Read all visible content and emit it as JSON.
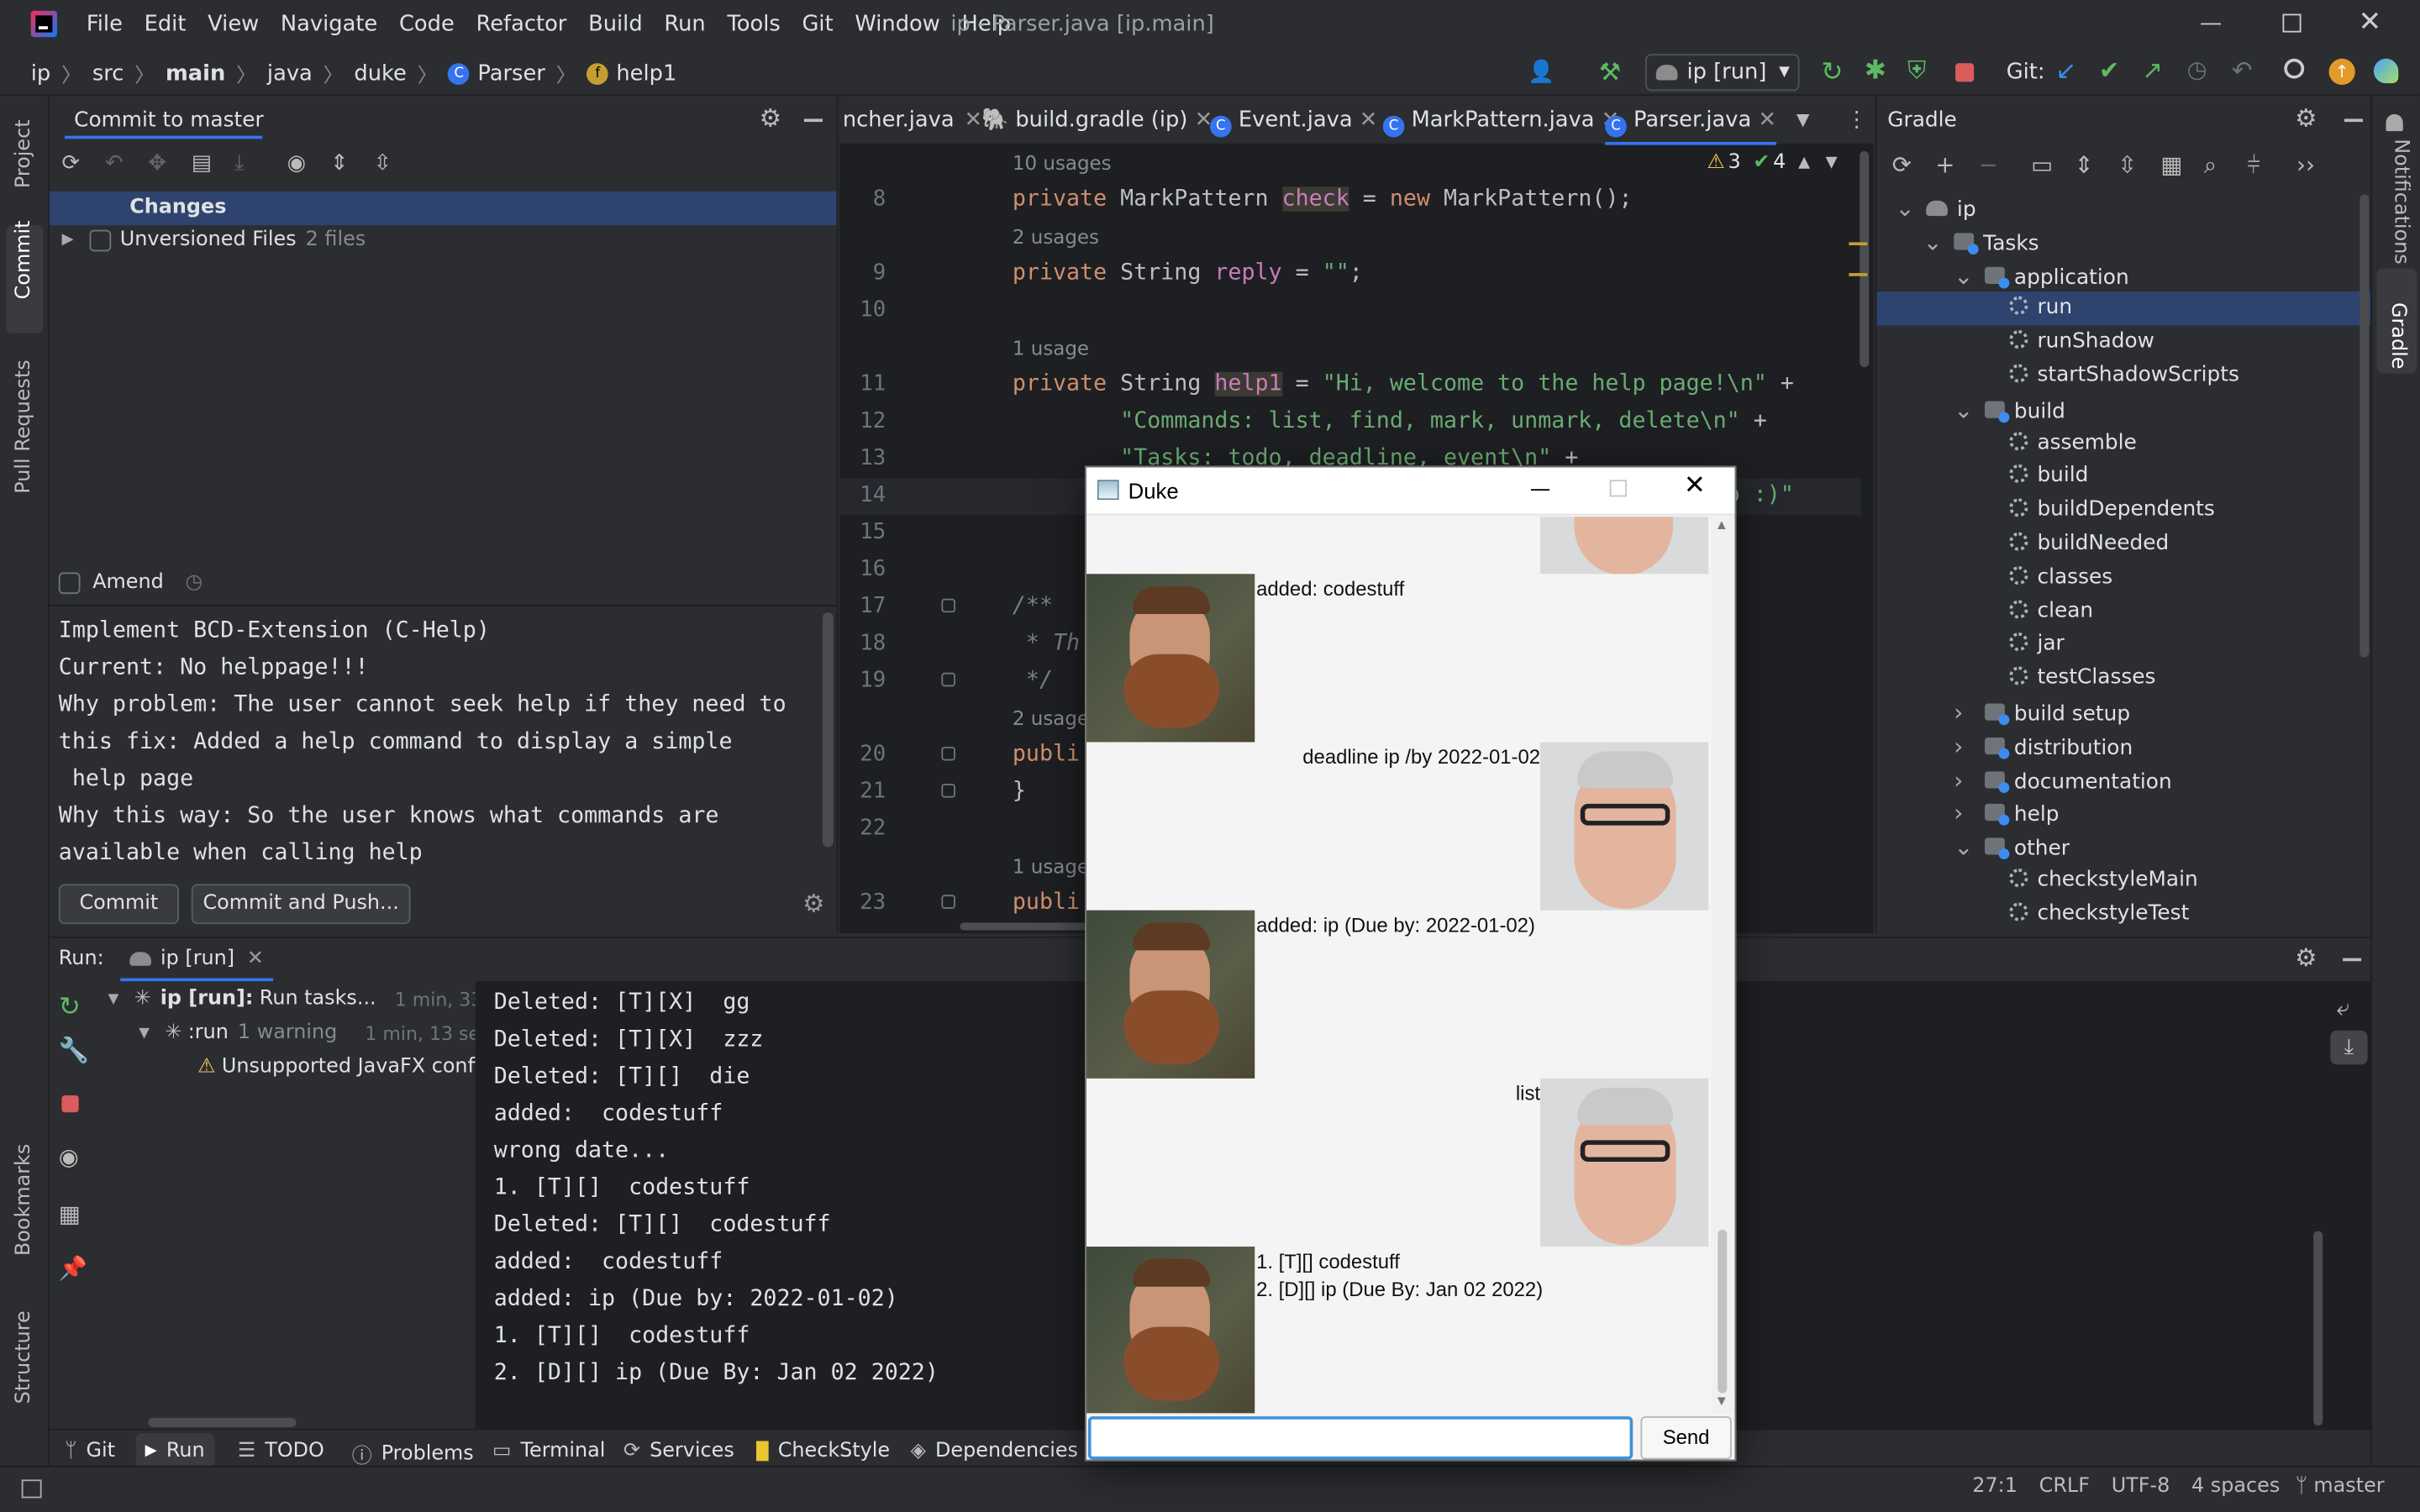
{
  "window": {
    "title": "ip - Parser.java [ip.main]"
  },
  "menu": [
    "File",
    "Edit",
    "View",
    "Navigate",
    "Code",
    "Refactor",
    "Build",
    "Run",
    "Tools",
    "Git",
    "Window",
    "Help"
  ],
  "breadcrumb": {
    "project": "ip",
    "src": "src",
    "main": "main",
    "java": "java",
    "pkg": "duke",
    "cls": "Parser",
    "field": "help1"
  },
  "toolbar": {
    "run_config": "ip [run]",
    "git_label": "Git:"
  },
  "left_stripe": {
    "project": "Project",
    "commit": "Commit",
    "pull_requests": "Pull Requests",
    "bookmarks": "Bookmarks",
    "structure": "Structure"
  },
  "commit_panel": {
    "title": "Commit to master",
    "changes_label": "Changes",
    "unversioned_label": "Unversioned Files",
    "unversioned_count": "2 files",
    "amend_label": "Amend",
    "message_lines": [
      "Implement BCD-Extension (C-Help)",
      "Current: No helppage!!!",
      "Why problem: The user cannot seek help if they need to",
      "this fix: Added a help command to display a simple",
      " help page",
      "Why this way: So the user knows what commands are",
      "available when calling help"
    ],
    "commit_button": "Commit",
    "commit_push_button": "Commit and Push..."
  },
  "editor": {
    "tabs": [
      "ncher.java",
      "build.gradle (ip)",
      "Event.java",
      "MarkPattern.java",
      "Parser.java"
    ],
    "warnings": "3",
    "weak_warnings": "4",
    "lines": [
      {
        "hint": "10 usages"
      },
      {
        "num": "8",
        "code": [
          [
            "kw",
            "private "
          ],
          [
            "",
            "MarkPattern "
          ],
          [
            "fld",
            "check"
          ],
          [
            "",
            " = "
          ],
          [
            "kw",
            "new "
          ],
          [
            "",
            "MarkPattern();"
          ]
        ]
      },
      {
        "hint": "2 usages"
      },
      {
        "num": "9",
        "code": [
          [
            "kw",
            "private "
          ],
          [
            "",
            "String "
          ],
          [
            "fld",
            "reply"
          ],
          [
            "",
            " = "
          ],
          [
            "str",
            "\"\""
          ],
          [
            "",
            ";"
          ]
        ]
      },
      {
        "num": "10",
        "code": []
      },
      {
        "hint": "1 usage"
      },
      {
        "num": "11",
        "code": [
          [
            "kw",
            "private "
          ],
          [
            "",
            "String "
          ],
          [
            "fld",
            "help1"
          ],
          [
            "",
            " = "
          ],
          [
            "str",
            "\"Hi, welcome to the help page!\\n\""
          ],
          [
            "",
            " +"
          ]
        ]
      },
      {
        "num": "12",
        "code": [
          [
            "",
            "        "
          ],
          [
            "str",
            "\"Commands: list, find, mark, unmark, delete\\n\""
          ],
          [
            "",
            " +"
          ]
        ]
      },
      {
        "num": "13",
        "code": [
          [
            "",
            "        "
          ],
          [
            "str",
            "\"Tasks: todo, deadline, event\\n\""
          ],
          [
            "",
            " +"
          ]
        ]
      },
      {
        "num": "14",
        "code": [
          [
            "",
            "        "
          ],
          [
            "str",
            "                                        github :)\""
          ]
        ]
      },
      {
        "num": "15",
        "code": []
      },
      {
        "num": "16",
        "code": []
      },
      {
        "num": "17",
        "code": [
          [
            "cm",
            "/**"
          ]
        ]
      },
      {
        "num": "18",
        "code": [
          [
            "cm",
            " * Th"
          ]
        ]
      },
      {
        "num": "19",
        "code": [
          [
            "cm",
            " */"
          ]
        ]
      },
      {
        "hint": "2 usage"
      },
      {
        "num": "20",
        "code": [
          [
            "kw",
            "publi"
          ]
        ]
      },
      {
        "num": "21",
        "code": [
          [
            "",
            "}"
          ]
        ]
      },
      {
        "num": "22",
        "code": []
      },
      {
        "hint": "1 usage"
      },
      {
        "num": "23",
        "code": [
          [
            "kw",
            "publi"
          ]
        ]
      }
    ]
  },
  "gradle": {
    "title": "Gradle",
    "tree": [
      {
        "label": "ip",
        "depth": 0,
        "kind": "project",
        "expanded": true
      },
      {
        "label": "Tasks",
        "depth": 1,
        "kind": "folder",
        "expanded": true
      },
      {
        "label": "application",
        "depth": 2,
        "kind": "folder",
        "expanded": true
      },
      {
        "label": "run",
        "depth": 3,
        "kind": "task",
        "selected": true
      },
      {
        "label": "runShadow",
        "depth": 3,
        "kind": "task"
      },
      {
        "label": "startShadowScripts",
        "depth": 3,
        "kind": "task"
      },
      {
        "label": "build",
        "depth": 2,
        "kind": "folder",
        "expanded": true
      },
      {
        "label": "assemble",
        "depth": 3,
        "kind": "task"
      },
      {
        "label": "build",
        "depth": 3,
        "kind": "task"
      },
      {
        "label": "buildDependents",
        "depth": 3,
        "kind": "task"
      },
      {
        "label": "buildNeeded",
        "depth": 3,
        "kind": "task"
      },
      {
        "label": "classes",
        "depth": 3,
        "kind": "task"
      },
      {
        "label": "clean",
        "depth": 3,
        "kind": "task"
      },
      {
        "label": "jar",
        "depth": 3,
        "kind": "task"
      },
      {
        "label": "testClasses",
        "depth": 3,
        "kind": "task"
      },
      {
        "label": "build setup",
        "depth": 2,
        "kind": "folder",
        "expanded": false
      },
      {
        "label": "distribution",
        "depth": 2,
        "kind": "folder",
        "expanded": false
      },
      {
        "label": "documentation",
        "depth": 2,
        "kind": "folder",
        "expanded": false
      },
      {
        "label": "help",
        "depth": 2,
        "kind": "folder",
        "expanded": false
      },
      {
        "label": "other",
        "depth": 2,
        "kind": "folder",
        "expanded": true
      },
      {
        "label": "checkstyleMain",
        "depth": 3,
        "kind": "task"
      },
      {
        "label": "checkstyleTest",
        "depth": 3,
        "kind": "task"
      }
    ]
  },
  "right_stripe": {
    "notifications": "Notifications",
    "gradle": "Gradle"
  },
  "run_panel": {
    "label": "Run:",
    "tab": "ip [run]",
    "tree": {
      "root_bold": "ip [run]:",
      "root": "Run tasks...",
      "root_time": "1 min, 33 sec",
      "child": ":run",
      "child_warn": "1 warning",
      "child_time": "1 min, 13 sec",
      "warning": "Unsupported JavaFX config"
    },
    "console": [
      "Deleted: [T][X]  gg",
      "Deleted: [T][X]  zzz",
      "Deleted: [T][]  die",
      "added:  codestuff",
      "wrong date...",
      "1. [T][]  codestuff",
      "Deleted: [T][]  codestuff",
      "added:  codestuff",
      "added: ip (Due by: 2022-01-02)",
      "1. [T][]  codestuff",
      "2. [D][] ip (Due By: Jan 02 2022)"
    ]
  },
  "bottom_tools": [
    "Git",
    "Run",
    "TODO",
    "Problems",
    "Terminal",
    "Services",
    "CheckStyle",
    "Dependencies"
  ],
  "status": {
    "position": "27:1",
    "line_sep": "CRLF",
    "encoding": "UTF-8",
    "indent": "4 spaces",
    "branch": "master"
  },
  "duke": {
    "title": "Duke",
    "messages": {
      "m1": "added:  codestuff",
      "m2": "deadline ip /by 2022-01-02",
      "m3": "added: ip (Due by: 2022-01-02)",
      "m4": "list",
      "m5a": "1. [T][]  codestuff",
      "m5b": "2. [D][] ip (Due By: Jan 02 2022)"
    },
    "input_value": "",
    "send_label": "Send"
  },
  "colors": {
    "accent": "#3574f0",
    "selection": "#2e436e",
    "run_green": "#5fb865",
    "stop_red": "#db5c5c",
    "warning": "#f2c55c"
  }
}
